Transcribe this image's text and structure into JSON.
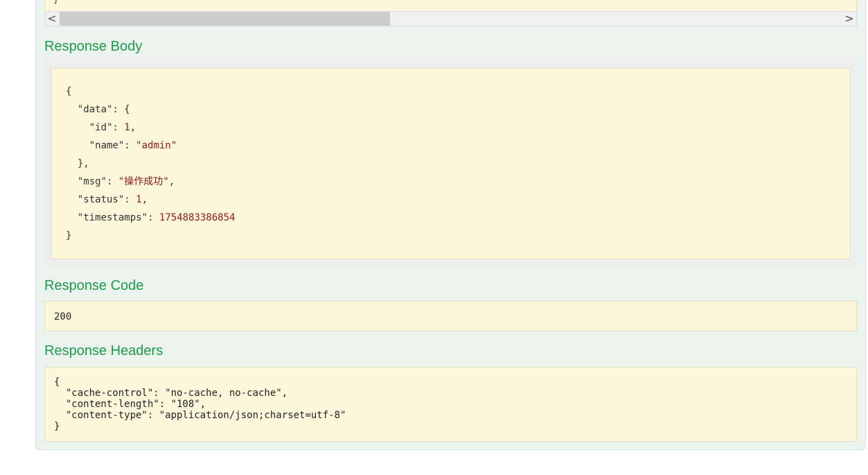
{
  "top_code": {
    "visible_fragment": "}"
  },
  "scrollbar": {
    "left_arrow": "<",
    "right_arrow": ">"
  },
  "response_body": {
    "title": "Response Body",
    "lines": [
      {
        "text": "{"
      },
      {
        "key": "  \"data\": ",
        "punct": "{"
      },
      {
        "key": "    \"id\": ",
        "num": "1",
        "punct": ","
      },
      {
        "key": "    \"name\": ",
        "str": "\"admin\""
      },
      {
        "text": "  },"
      },
      {
        "key": "  \"msg\": ",
        "str": "\"操作成功\"",
        "punct": ","
      },
      {
        "key": "  \"status\": ",
        "num": "1",
        "punct": ","
      },
      {
        "key": "  \"timestamps\": ",
        "num": "1754883386854"
      },
      {
        "text": "}"
      }
    ]
  },
  "response_code": {
    "title": "Response Code",
    "value": "200"
  },
  "response_headers": {
    "title": "Response Headers",
    "lines": [
      "{",
      "  \"cache-control\": \"no-cache, no-cache\",",
      "  \"content-length\": \"108\",",
      "  \"content-type\": \"application/json;charset=utf-8\"",
      "}"
    ]
  }
}
